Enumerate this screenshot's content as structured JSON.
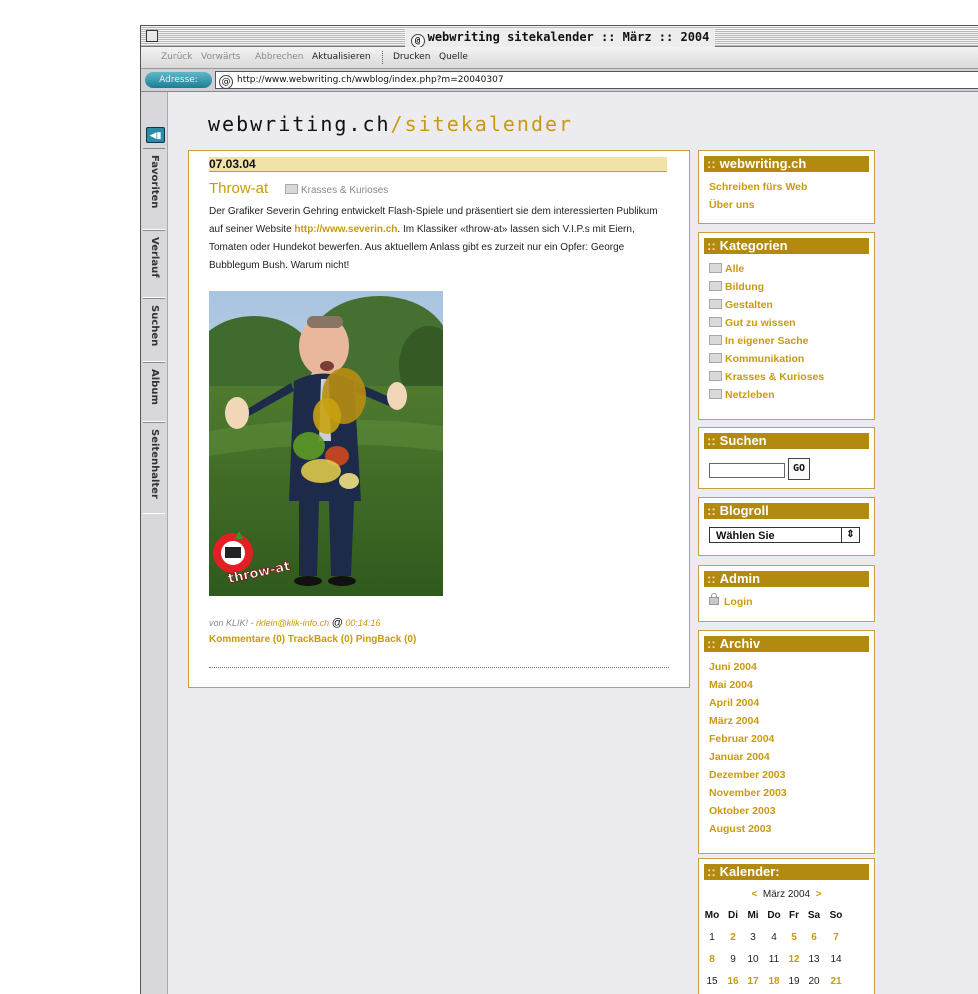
{
  "window": {
    "title": "webwriting sitekalender :: März :: 2004"
  },
  "toolbar": {
    "back": "Zurück",
    "forward": "Vorwärts",
    "stop": "Abbrechen",
    "reload": "Aktualisieren",
    "print": "Drucken",
    "source": "Quelle"
  },
  "address": {
    "label": "Adresse:",
    "url": "http://www.webwriting.ch/wwblog/index.php?m=20040307"
  },
  "sidetabs": [
    "Favoriten",
    "Verlauf",
    "Suchen",
    "Album",
    "Seitenhalter"
  ],
  "logo": {
    "main": "webwriting.ch",
    "sub": "/sitekalender"
  },
  "post": {
    "date": "07.03.04",
    "title": "Throw-at",
    "category": "Krasses & Kurioses",
    "body_1": "Der Grafiker Severin Gehring entwickelt Flash-Spiele und präsentiert sie dem interessierten Publikum auf seiner Website ",
    "body_link": "http://www.severin.ch",
    "body_2": ". Im Klassiker «throw-at» lassen sich V.I.P.s mit Eiern, Tomaten oder Hundekot bewerfen. Aus aktuellem Anlass gibt es zurzeit nur ein Opfer: George Bubblegum Bush. Warum nicht!",
    "image_logo_text": "throw-at",
    "meta_by": "von KLIK! - ",
    "meta_email": "rklein@klik-info.ch",
    "meta_at": "@",
    "meta_time": "00:14:16",
    "comments": "Kommentare (0)",
    "trackback": "TrackBack (0)",
    "pingback": "PingBack (0)"
  },
  "sidebar": {
    "prefix": "::",
    "site": {
      "title": "webwriting.ch",
      "links": [
        "Schreiben fürs Web",
        "Über uns"
      ]
    },
    "categories": {
      "title": "Kategorien",
      "items": [
        "Alle",
        "Bildung",
        "Gestalten",
        "Gut zu wissen",
        "In eigener Sache",
        "Kommunikation",
        "Krasses & Kurioses",
        "Netzleben"
      ]
    },
    "search": {
      "title": "Suchen",
      "button": "GO",
      "value": ""
    },
    "blogroll": {
      "title": "Blogroll",
      "selected": "Wählen Sie",
      "arrow": "⇕"
    },
    "admin": {
      "title": "Admin",
      "login": "Login"
    },
    "archive": {
      "title": "Archiv",
      "items": [
        "Juni 2004",
        "Mai 2004",
        "April 2004",
        "März 2004",
        "Februar 2004",
        "Januar 2004",
        "Dezember 2003",
        "November 2003",
        "Oktober 2003",
        "August 2003"
      ]
    },
    "calendar": {
      "title": "Kalender:",
      "prev": "<",
      "month": "März 2004",
      "next": ">",
      "weekdays": [
        "Mo",
        "Di",
        "Mi",
        "Do",
        "Fr",
        "Sa",
        "So"
      ],
      "rows": [
        [
          {
            "d": "1",
            "l": false
          },
          {
            "d": "2",
            "l": true
          },
          {
            "d": "3",
            "l": false
          },
          {
            "d": "4",
            "l": false
          },
          {
            "d": "5",
            "l": true
          },
          {
            "d": "6",
            "l": true
          },
          {
            "d": "7",
            "l": true
          }
        ],
        [
          {
            "d": "8",
            "l": true
          },
          {
            "d": "9",
            "l": false
          },
          {
            "d": "10",
            "l": false
          },
          {
            "d": "11",
            "l": false
          },
          {
            "d": "12",
            "l": true
          },
          {
            "d": "13",
            "l": false
          },
          {
            "d": "14",
            "l": false
          }
        ],
        [
          {
            "d": "15",
            "l": false
          },
          {
            "d": "16",
            "l": true
          },
          {
            "d": "17",
            "l": true
          },
          {
            "d": "18",
            "l": true
          },
          {
            "d": "19",
            "l": false
          },
          {
            "d": "20",
            "l": false
          },
          {
            "d": "21",
            "l": true
          }
        ]
      ]
    }
  }
}
